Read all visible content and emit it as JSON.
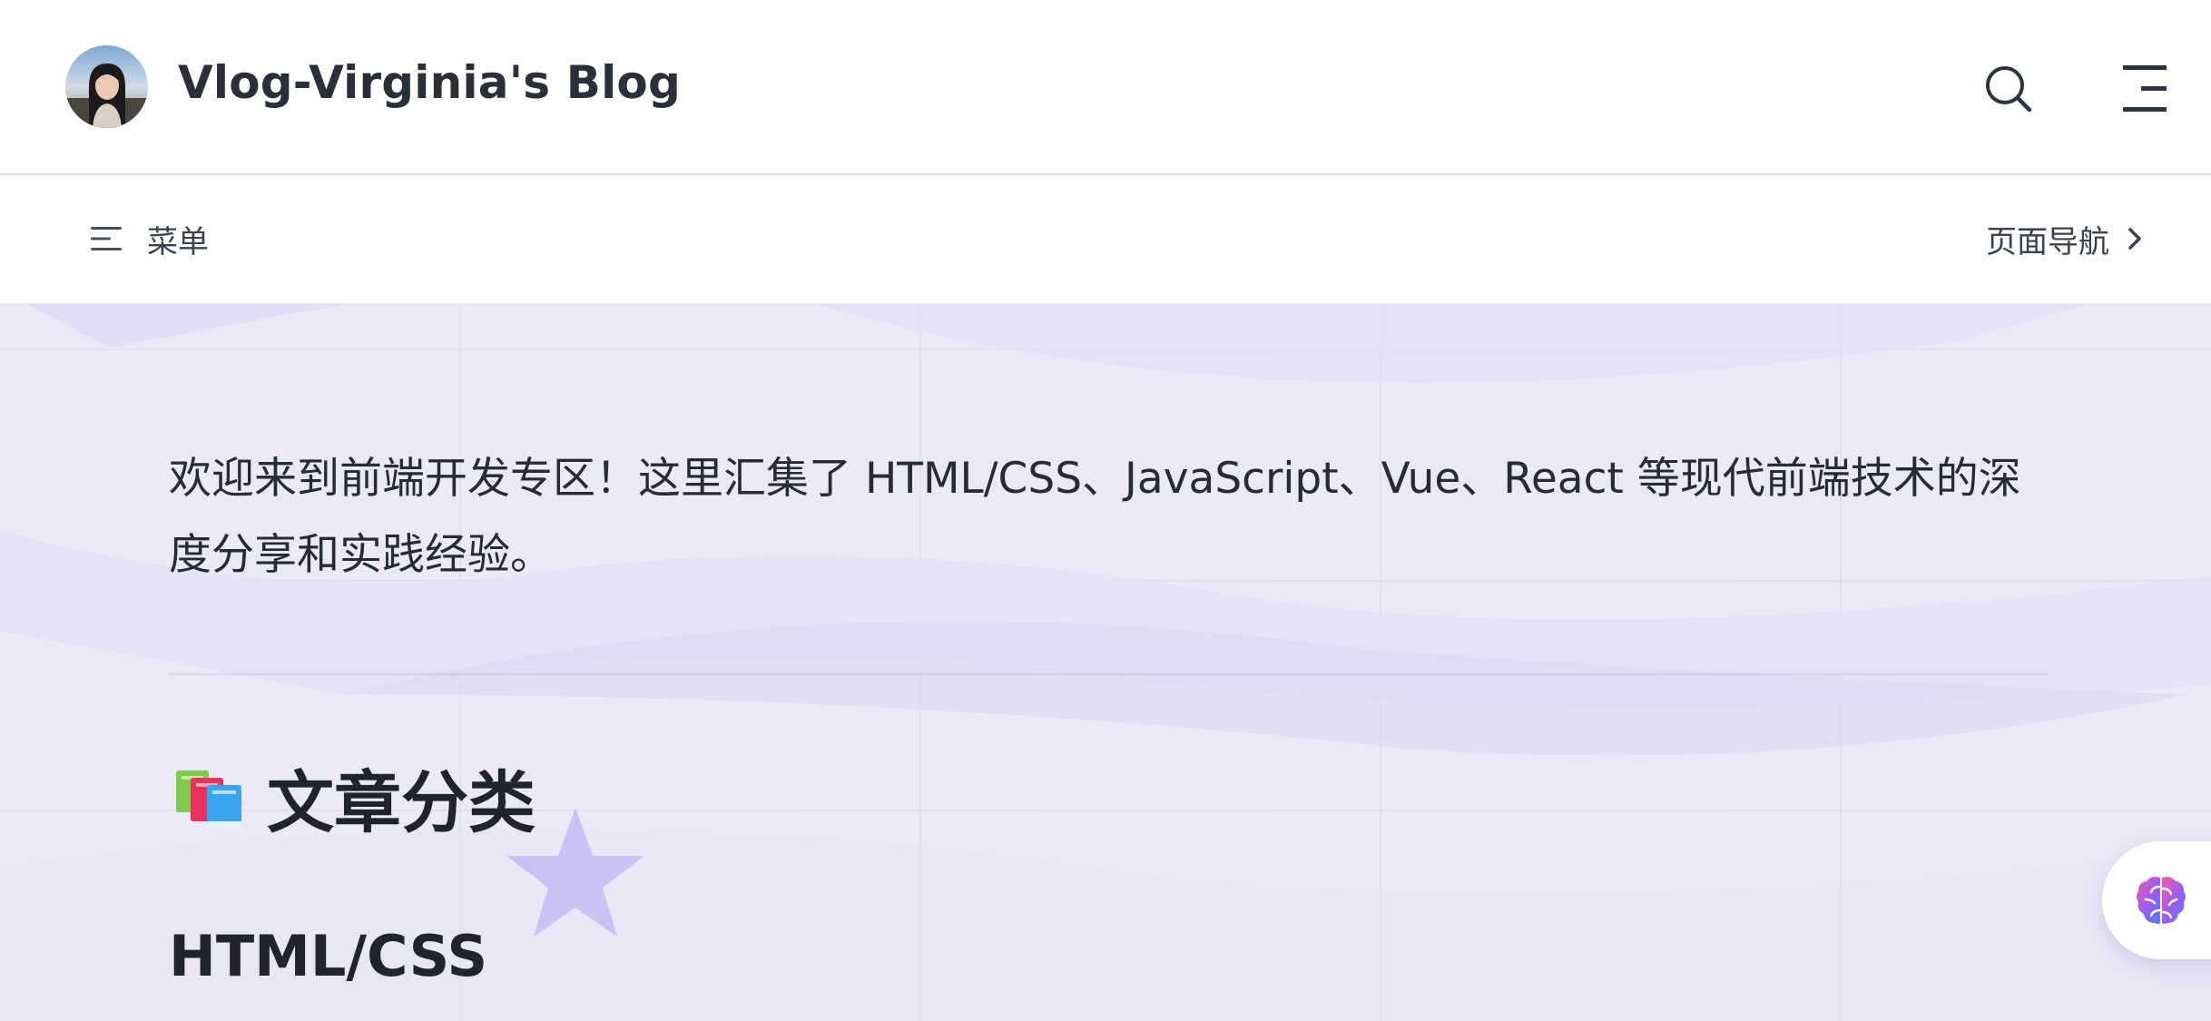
{
  "header": {
    "site_title": "Vlog-Virginia's Blog",
    "avatar_icon": "user-avatar-photo",
    "search_icon": "search-icon",
    "menu_icon": "hamburger-menu-icon"
  },
  "subnav": {
    "menu_label": "菜单",
    "menu_icon": "list-lines-icon",
    "page_nav_label": "页面导航",
    "page_nav_icon": "chevron-right-icon"
  },
  "content": {
    "intro_text": "欢迎来到前端开发专区！这里汇集了 HTML/CSS、JavaScript、Vue、React 等现代前端技术的深度分享和实践经验。",
    "section_emoji": "📚",
    "section_title": "文章分类",
    "subsection_title": "HTML/CSS"
  },
  "floating": {
    "ai_assistant_icon": "ai-brain-icon"
  },
  "colors": {
    "content_bg": "#ebe8f8",
    "star_deco": "#c9bdf3",
    "text_dark": "#20242e"
  }
}
